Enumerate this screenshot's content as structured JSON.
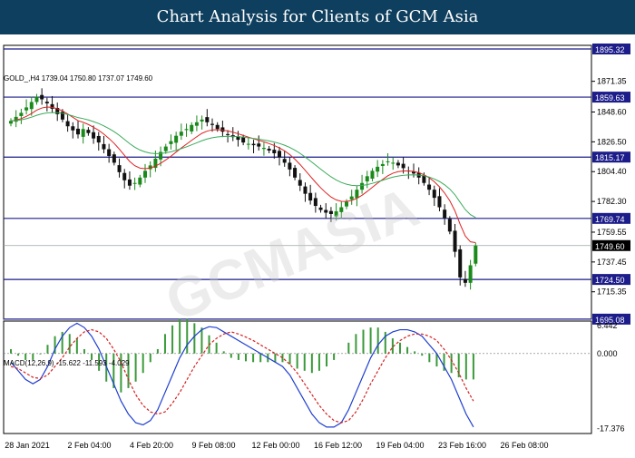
{
  "header": {
    "title": "Chart Analysis for Clients of GCM Asia"
  },
  "symbol_line": "GOLD_,H4  1739.04 1750.80 1737.07 1749.60",
  "macd_line": "MACD(12,26,9) -15.622 -11.593 -4.029",
  "watermark": "GCMASIA",
  "colors": {
    "bull": "#1a8a1a",
    "bear": "#111111",
    "ema_fast": "#e02020",
    "ema_slow": "#3aaa5a",
    "level": "#1c1c8a",
    "macd_line": "#1f3fd0",
    "signal": "#d62020",
    "hist": "#3a9a3a"
  },
  "chart_data": [
    {
      "type": "candlestick",
      "title": "",
      "y_ticks": [
        1871.35,
        1848.6,
        1826.5,
        1804.4,
        1782.3,
        1759.55,
        1737.45,
        1715.35
      ],
      "ylim": [
        1695,
        1898
      ],
      "x_tick_labels": [
        "28 Jan 2021",
        "2 Feb 04:00",
        "4 Feb 20:00",
        "9 Feb 08:00",
        "12 Feb 00:00",
        "16 Feb 12:00",
        "19 Feb 04:00",
        "23 Feb 16:00",
        "26 Feb 08:00"
      ],
      "levels": [
        1895.32,
        1859.63,
        1815.17,
        1769.74,
        1724.5,
        1695.08
      ],
      "last_price": 1749.6,
      "closes": [
        1842,
        1845,
        1848,
        1852,
        1856,
        1860,
        1858,
        1855,
        1851,
        1847,
        1843,
        1838,
        1835,
        1832,
        1836,
        1833,
        1829,
        1826,
        1821,
        1816,
        1811,
        1804,
        1798,
        1794,
        1796,
        1800,
        1805,
        1809,
        1814,
        1819,
        1823,
        1827,
        1831,
        1834,
        1836,
        1839,
        1841,
        1843,
        1841,
        1839,
        1836,
        1834,
        1832,
        1830,
        1828,
        1826,
        1825,
        1824,
        1823,
        1822,
        1820,
        1818,
        1815,
        1811,
        1806,
        1800,
        1794,
        1788,
        1783,
        1779,
        1776,
        1774,
        1773,
        1775,
        1778,
        1782,
        1786,
        1791,
        1796,
        1801,
        1805,
        1808,
        1810,
        1812,
        1811,
        1809,
        1807,
        1805,
        1803,
        1800,
        1796,
        1791,
        1785,
        1778,
        1770,
        1760,
        1745,
        1726,
        1722,
        1735,
        1749.6
      ],
      "series": [
        {
          "name": "EMA fast",
          "color": "#e02020"
        },
        {
          "name": "EMA slow",
          "color": "#3aaa5a"
        }
      ]
    },
    {
      "type": "line",
      "title": "MACD(12,26,9)",
      "y_ticks": [
        6.442,
        0.0,
        -17.376
      ],
      "ylim": [
        -18.5,
        7.5
      ],
      "macd": [
        -2,
        -4,
        -6,
        -7,
        -6,
        -3,
        1,
        4,
        6,
        7,
        6,
        4,
        1,
        -3,
        -7,
        -11,
        -14,
        -16,
        -16.5,
        -15.5,
        -13,
        -9,
        -5,
        -1,
        2,
        4,
        5.5,
        6.2,
        6,
        5,
        4,
        3,
        2,
        1,
        0,
        -1,
        -2,
        -3,
        -5,
        -8,
        -11,
        -14,
        -16,
        -17,
        -17,
        -16,
        -13,
        -9,
        -5,
        -1,
        2,
        4,
        5,
        5.5,
        5.5,
        5,
        4,
        2,
        0,
        -3,
        -6,
        -10,
        -14,
        -17
      ],
      "signal": [
        -3,
        -3.5,
        -4.5,
        -5.5,
        -5.8,
        -5,
        -3,
        -1,
        1.5,
        3.5,
        5,
        5.5,
        5,
        3.5,
        1,
        -2,
        -6,
        -9.5,
        -12,
        -13.5,
        -14,
        -13.5,
        -11.5,
        -9,
        -6,
        -3,
        -0.5,
        2,
        3.5,
        4.5,
        5,
        4.5,
        3.8,
        3,
        2,
        1,
        0,
        -1,
        -2.5,
        -4.5,
        -7,
        -9.5,
        -12,
        -14,
        -15.5,
        -16,
        -15.5,
        -13.5,
        -10.5,
        -7,
        -4,
        -1,
        1.5,
        3,
        4,
        4.5,
        4.5,
        4,
        3,
        1,
        -1.5,
        -4.5,
        -8,
        -11
      ]
    }
  ]
}
